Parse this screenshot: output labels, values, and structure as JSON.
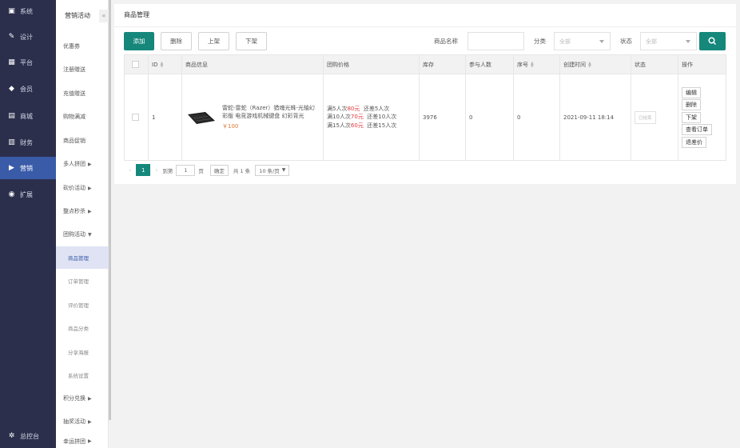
{
  "nav": {
    "items": [
      {
        "label": "系统",
        "icon": "system-icon"
      },
      {
        "label": "设计",
        "icon": "design-icon"
      },
      {
        "label": "平台",
        "icon": "platform-icon"
      },
      {
        "label": "会员",
        "icon": "member-icon"
      },
      {
        "label": "商城",
        "icon": "shop-icon"
      },
      {
        "label": "财务",
        "icon": "finance-icon"
      },
      {
        "label": "营销",
        "icon": "marketing-icon"
      },
      {
        "label": "扩展",
        "icon": "extension-icon"
      }
    ],
    "bottom_label": "总控台"
  },
  "subnav": {
    "title": "营销活动",
    "collapse_glyph": "«",
    "items": [
      "优惠券",
      "注册赠送",
      "充值赠送",
      "购物满减",
      "商品促销"
    ],
    "expandable": [
      "多人拼团",
      "砍价活动",
      "整点秒杀",
      "团购活动"
    ],
    "children": [
      "商品管理",
      "订单管理",
      "评价管理",
      "商品分类",
      "分享海报",
      "系统设置"
    ],
    "more": [
      "积分兑换",
      "抽奖活动",
      "幸运拼团"
    ]
  },
  "card": {
    "title": "商品管理"
  },
  "toolbar": {
    "add": "添加",
    "delete": "删除",
    "up": "上架",
    "down": "下架",
    "name_label": "商品名称",
    "category_label": "分类",
    "category_value": "全部",
    "status_label": "状态",
    "status_value": "全部"
  },
  "table": {
    "headers": [
      "ID",
      "商品信息",
      "团购价格",
      "库存",
      "参与人数",
      "序号",
      "创建时间",
      "状态",
      "操作"
    ],
    "row": {
      "id": "1",
      "name": "雷蛇-雷蛇（Razer）猎魂光蛛-光轴幻彩版 电竞游戏机械键盘 幻彩背光",
      "price": "￥100",
      "tiers": [
        {
          "a": "满5人次",
          "price": "80元",
          "b": "还差5人次"
        },
        {
          "a": "满10人次",
          "price": "70元",
          "b": "还差10人次"
        },
        {
          "a": "满15人次",
          "price": "60元",
          "b": "还差15人次"
        }
      ],
      "stock": "3976",
      "participants": "0",
      "order": "0",
      "created": "2021-09-11 18:14",
      "status": "已结束",
      "actions": [
        "编辑",
        "删除",
        "下架",
        "查看订单",
        "退差价"
      ]
    }
  },
  "pager": {
    "prev": "‹",
    "current": "1",
    "next": "›",
    "goto_label": "到第",
    "page_value": "1",
    "page_unit": "页",
    "confirm": "确定",
    "total": "共 1 条",
    "size": "10 条/页"
  },
  "colors": {
    "nav_bg": "#2b2f4c",
    "nav_active": "#3a5ba8",
    "accent": "#16877b"
  }
}
